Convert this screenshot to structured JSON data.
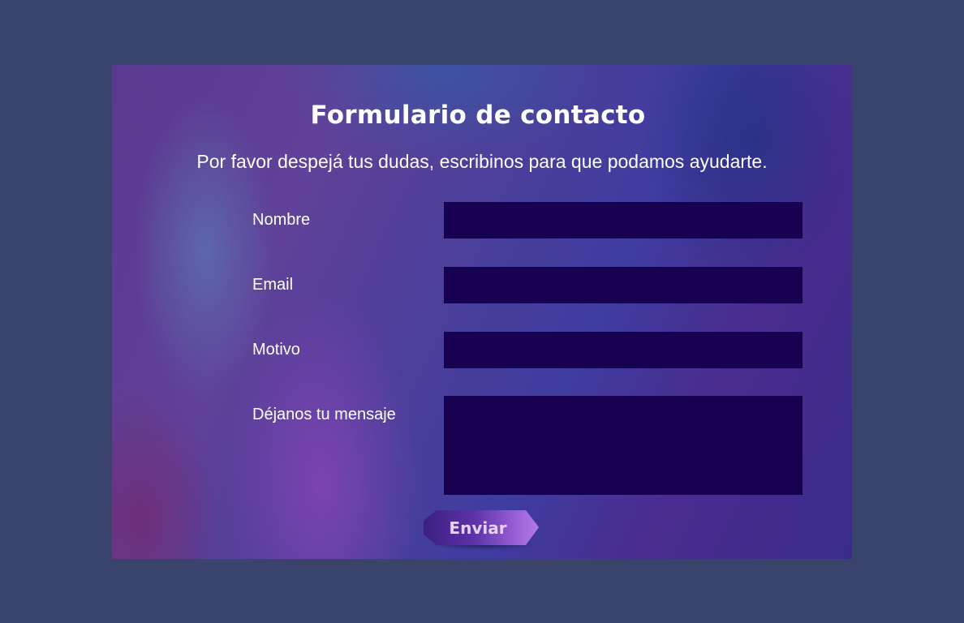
{
  "form": {
    "title": "Formulario de contacto",
    "subtitle": "Por favor despejá tus dudas, escribinos para que podamos ayudarte.",
    "fields": [
      {
        "label": "Nombre",
        "value": ""
      },
      {
        "label": "Email",
        "value": ""
      },
      {
        "label": "Motivo",
        "value": ""
      },
      {
        "label": "Déjanos tu mensaje",
        "value": ""
      }
    ],
    "submit_label": "Enviar"
  },
  "colors": {
    "page_background": "#39436b",
    "input_background": "#170050",
    "text": "#ffffff",
    "button_accent": "#9a5fd6"
  }
}
